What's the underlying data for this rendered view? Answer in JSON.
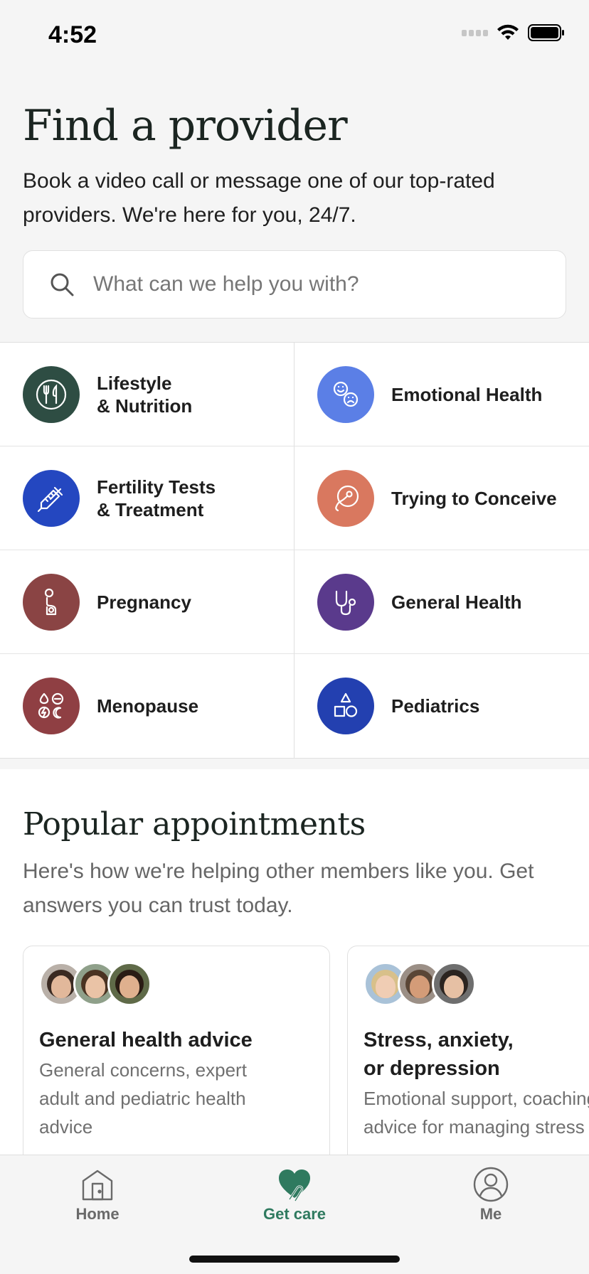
{
  "status_bar": {
    "time": "4:52"
  },
  "header": {
    "title": "Find a provider",
    "subtitle": "Book a video call or message one of our top-rated providers. We're here for you, 24/7."
  },
  "search": {
    "placeholder": "What can we help you with?",
    "icon": "search-icon"
  },
  "categories": [
    {
      "label": "Lifestyle\n& Nutrition",
      "icon": "fork-knife-icon",
      "color": "#2e4d43"
    },
    {
      "label": "Emotional Health",
      "icon": "faces-icon",
      "color": "#5b7fe6"
    },
    {
      "label": "Fertility Tests\n& Treatment",
      "icon": "syringe-icon",
      "color": "#2447c0"
    },
    {
      "label": "Trying to Conceive",
      "icon": "sperm-egg-icon",
      "color": "#d9785f"
    },
    {
      "label": "Pregnancy",
      "icon": "pregnancy-icon",
      "color": "#8a4444"
    },
    {
      "label": "General Health",
      "icon": "stethoscope-icon",
      "color": "#5a3a8c"
    },
    {
      "label": "Menopause",
      "icon": "menopause-symbols-icon",
      "color": "#8f3f43"
    },
    {
      "label": "Pediatrics",
      "icon": "shapes-icon",
      "color": "#2340b0"
    }
  ],
  "popular": {
    "title": "Popular appointments",
    "subtitle": "Here's how we're helping other members like you. Get answers you can trust today.",
    "cards": [
      {
        "title": "General health advice",
        "description": "General concerns, expert\nadult and pediatric health\nadvice"
      },
      {
        "title": "Stress, anxiety,\nor depression",
        "description": "Emotional support, coaching,\nadvice for managing stress"
      }
    ]
  },
  "tab_bar": {
    "tabs": [
      {
        "label": "Home",
        "icon": "home-icon"
      },
      {
        "label": "Get care",
        "icon": "heart-hand-icon",
        "active": true
      },
      {
        "label": "Me",
        "icon": "person-icon"
      }
    ],
    "active_color": "#2f7a5f"
  }
}
